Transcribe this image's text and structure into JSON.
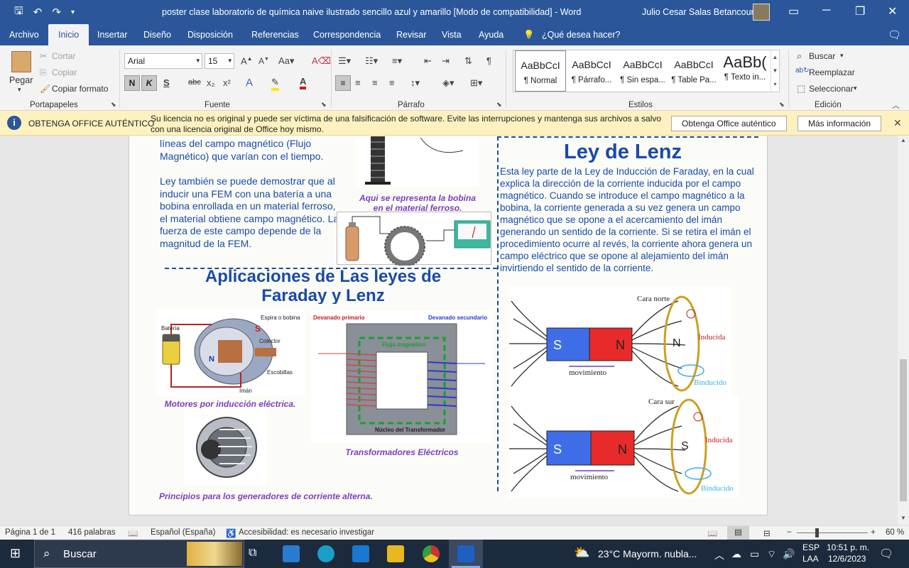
{
  "window": {
    "title": "poster clase laboratorio de química naive ilustrado sencillo azul y amarillo [Modo de compatibilidad]  -  Word",
    "user": "Julio Cesar Salas Betancourt"
  },
  "menu": [
    "Archivo",
    "Inicio",
    "Insertar",
    "Diseño",
    "Disposición",
    "Referencias",
    "Correspondencia",
    "Revisar",
    "Vista",
    "Ayuda",
    "¿Qué desea hacer?"
  ],
  "ribbon": {
    "clipboard": {
      "paste": "Pegar",
      "cut": "Cortar",
      "copy": "Copiar",
      "format_painter": "Copiar formato",
      "label": "Portapapeles"
    },
    "font": {
      "name": "Arial",
      "size": "15",
      "label": "Fuente",
      "bold": "N",
      "italic": "K",
      "underline": "S",
      "strike": "abc",
      "sub": "x₂",
      "sup": "x²"
    },
    "paragraph": {
      "label": "Párrafo"
    },
    "styles": {
      "label": "Estilos",
      "items": [
        {
          "preview": "AaBbCcI",
          "name": "¶ Normal"
        },
        {
          "preview": "AaBbCcI",
          "name": "¶ Párrafo..."
        },
        {
          "preview": "AaBbCcI",
          "name": "¶ Sin espa..."
        },
        {
          "preview": "AaBbCcI",
          "name": "¶ Table Pa..."
        },
        {
          "preview": "AaBb(",
          "name": "¶ Texto in..."
        }
      ]
    },
    "editing": {
      "find": "Buscar",
      "replace": "Reemplazar",
      "select": "Seleccionar",
      "label": "Edición"
    }
  },
  "notice": {
    "heading": "OBTENGA OFFICE AUTÉNTICO",
    "text": "Su licencia no es original y puede ser víctima de una falsificación de software. Evite las interrupciones y mantenga sus archivos a salvo con una licencia original de Office hoy mismo.",
    "btn1": "Obtenga Office auténtico",
    "btn2": "Más información"
  },
  "document": {
    "left_text1": "líneas del campo magnético (Flujo Magnético) que varían con el tiempo.",
    "left_text2": "Ley también se puede demostrar que al inducir una FEM con una batería a una bobina enrollada en un material ferroso, el material obtiene campo magnético. La fuerza de este campo depende de la magnitud de la FEM.",
    "caption_bobina": "Aqui se representa la bobina en el material ferroso.",
    "apps_heading": "Aplicaciones de Las leyes de Faraday y Lenz",
    "caption_motor": "Motores por inducción eléctrica.",
    "caption_transf": "Transformadores Eléctricos",
    "caption_gen": "Principios para los generadores de corriente alterna.",
    "lenz_heading": "Ley de Lenz",
    "lenz_text": "Esta ley parte de la Ley de Inducción de Faraday, en la cual explica la dirección de la corriente inducida por el campo magnético. Cuando se introduce el campo magnético a la bobina, la corriente generada a su vez genera un campo magnético que se opone a el acercamiento del imán generando un sentido de la corriente. Si se retira el imán el procedimiento ocurre al revés, la corriente ahora genera un campo eléctrico que se opone al alejamiento del imán invirtiendo el sentido de la corriente.",
    "motor_labels": {
      "bat": "Batería",
      "espira": "Espira o bobina",
      "s": "S",
      "n": "N",
      "colector": "Colector",
      "escobillas": "Escobillas",
      "iman": "Imán"
    },
    "transf_labels": {
      "prim": "Devanado primario",
      "sec": "Devanado secundario",
      "flujo": "Flujo magnético",
      "nucleo": "Núcleo del Transformador"
    },
    "lenz1": {
      "s": "S",
      "n": "N",
      "cara": "Cara norte",
      "mov": "movimiento",
      "ind": "Inducida",
      "binduc": "Binducido",
      "coilN": "N"
    },
    "lenz2": {
      "s": "S",
      "n": "N",
      "cara": "Cara sur",
      "mov": "movimiento",
      "ind": "Inducida",
      "binduc": "Binducido",
      "coilS": "S"
    }
  },
  "status": {
    "page": "Página 1 de 1",
    "words": "416 palabras",
    "lang": "Español (España)",
    "access": "Accesibilidad: es necesario investigar",
    "zoom": "60 %"
  },
  "taskbar": {
    "search": "Buscar",
    "weather": "23°C  Mayorm. nubla...",
    "lang1": "ESP",
    "lang2": "LAA",
    "time": "10:51 p. m.",
    "date": "12/6/2023"
  }
}
